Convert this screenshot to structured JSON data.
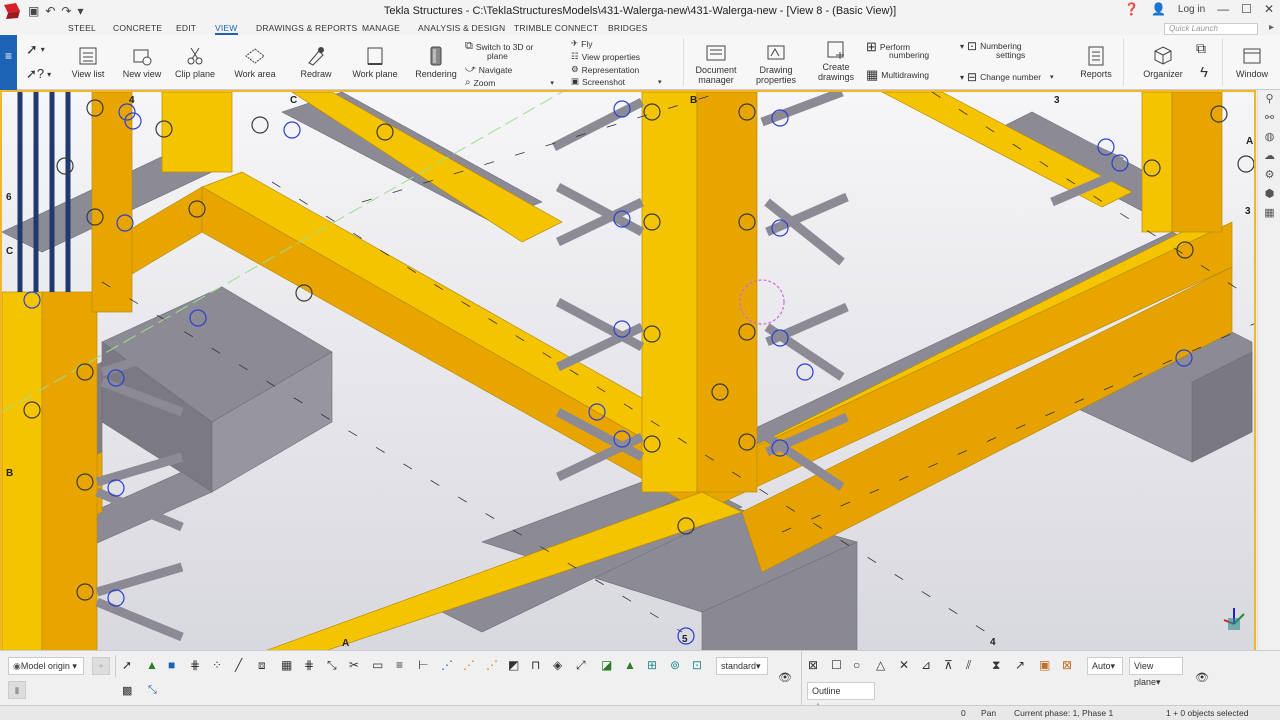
{
  "window": {
    "title": "Tekla Structures - C:\\TeklaStructuresModels\\431-Walerga-new\\431-Walerga-new - [View 8 - (Basic View)]",
    "login": "Log in"
  },
  "tabs": [
    "STEEL",
    "CONCRETE",
    "EDIT",
    "VIEW",
    "DRAWINGS & REPORTS",
    "MANAGE",
    "ANALYSIS & DESIGN",
    "TRIMBLE CONNECT",
    "BRIDGES"
  ],
  "active_tab": "VIEW",
  "quick_launch_placeholder": "Quick Launch",
  "ribbon": {
    "view_list": "View list",
    "new_view": "New view",
    "clip_plane": "Clip plane",
    "work_area": "Work area",
    "redraw": "Redraw",
    "work_plane": "Work plane",
    "rendering": "Rendering",
    "switch_3d": "Switch to 3D or",
    "switch_3d_2": "plane",
    "navigate": "Navigate",
    "zoom": "Zoom",
    "fly": "Fly",
    "view_properties": "View properties",
    "representation": "Representation",
    "screenshot": "Screenshot",
    "document_manager": "Document",
    "document_manager_2": "manager",
    "drawing_properties": "Drawing",
    "drawing_properties_2": "properties",
    "create_drawings": "Create",
    "create_drawings_2": "drawings",
    "perform_numbering": "Perform",
    "perform_numbering_2": "numbering",
    "multidrawing": "Multidrawing",
    "numbering_settings": "Numbering",
    "numbering_settings_2": "settings",
    "change_number": "Change number",
    "reports": "Reports",
    "organizer": "Organizer",
    "window": "Window"
  },
  "grid_labels": {
    "top": [
      "4",
      "C",
      "B",
      "3"
    ],
    "left": [
      "6",
      "C",
      "B"
    ],
    "right": [
      "A",
      "3"
    ],
    "bottom": [
      "A",
      "5",
      "4"
    ]
  },
  "bottom": {
    "model_origin": "Model origin",
    "standard": "standard",
    "auto": "Auto",
    "view_plane": "View plane",
    "outline_planes": "Outline planes"
  },
  "status": {
    "count": "0",
    "mode": "Pan",
    "phase": "Current phase: 1, Phase 1",
    "selection": "1 + 0 objects selected"
  },
  "colors": {
    "accent": "#1d63b5",
    "formwork": "#f5c400",
    "concrete": "#8c8a95",
    "viewport_bg": "#e9e9ee"
  }
}
